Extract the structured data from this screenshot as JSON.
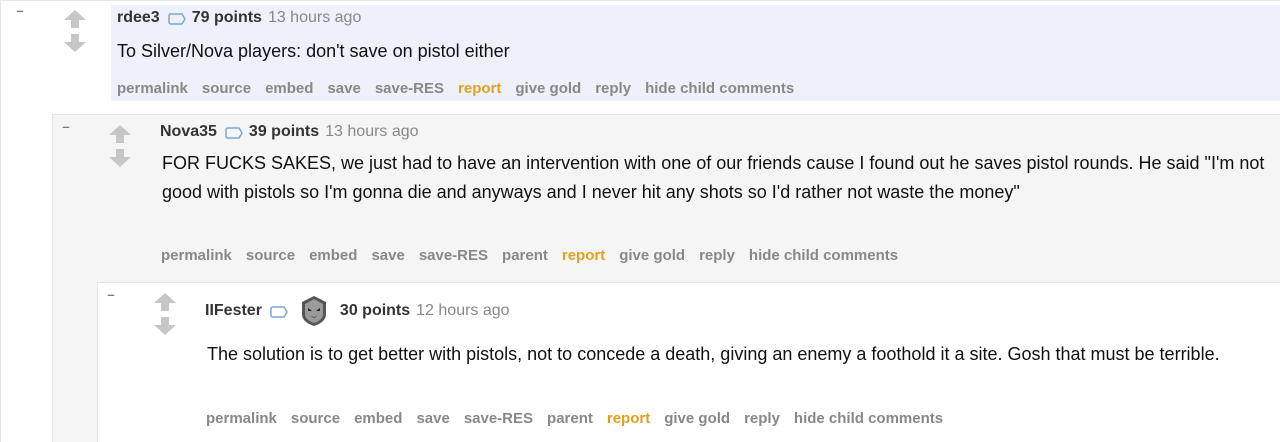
{
  "colors": {
    "highlight_bg": "#eef0fb",
    "report_link": "#e0a020",
    "muted_text": "#888888"
  },
  "comments": [
    {
      "collapse_label": "–",
      "author": "rdee3",
      "score": "79 points",
      "time": "13 hours ago",
      "body": "To Silver/Nova players: don't save on pistol either",
      "buttons": [
        "permalink",
        "source",
        "embed",
        "save",
        "save-RES",
        "report",
        "give gold",
        "reply",
        "hide child comments"
      ]
    },
    {
      "collapse_label": "–",
      "author": "Nova35",
      "score": "39 points",
      "time": "13 hours ago",
      "body": "FOR FUCKS SAKES, we just had to have an intervention with one of our friends cause I found out he saves pistol rounds. He said \"I'm not good with pistols so I'm gonna die and anyways and I never hit any shots so I'd rather not waste the money\"",
      "buttons": [
        "permalink",
        "source",
        "embed",
        "save",
        "save-RES",
        "parent",
        "report",
        "give gold",
        "reply",
        "hide child comments"
      ]
    },
    {
      "collapse_label": "–",
      "author": "IIFester",
      "flair_icon": "g2-team-logo-icon",
      "score": "30 points",
      "time": "12 hours ago",
      "body": "The solution is to get better with pistols, not to concede a death, giving an enemy a foothold it a site. Gosh that must be terrible.",
      "buttons": [
        "permalink",
        "source",
        "embed",
        "save",
        "save-RES",
        "parent",
        "report",
        "give gold",
        "reply",
        "hide child comments"
      ]
    }
  ]
}
